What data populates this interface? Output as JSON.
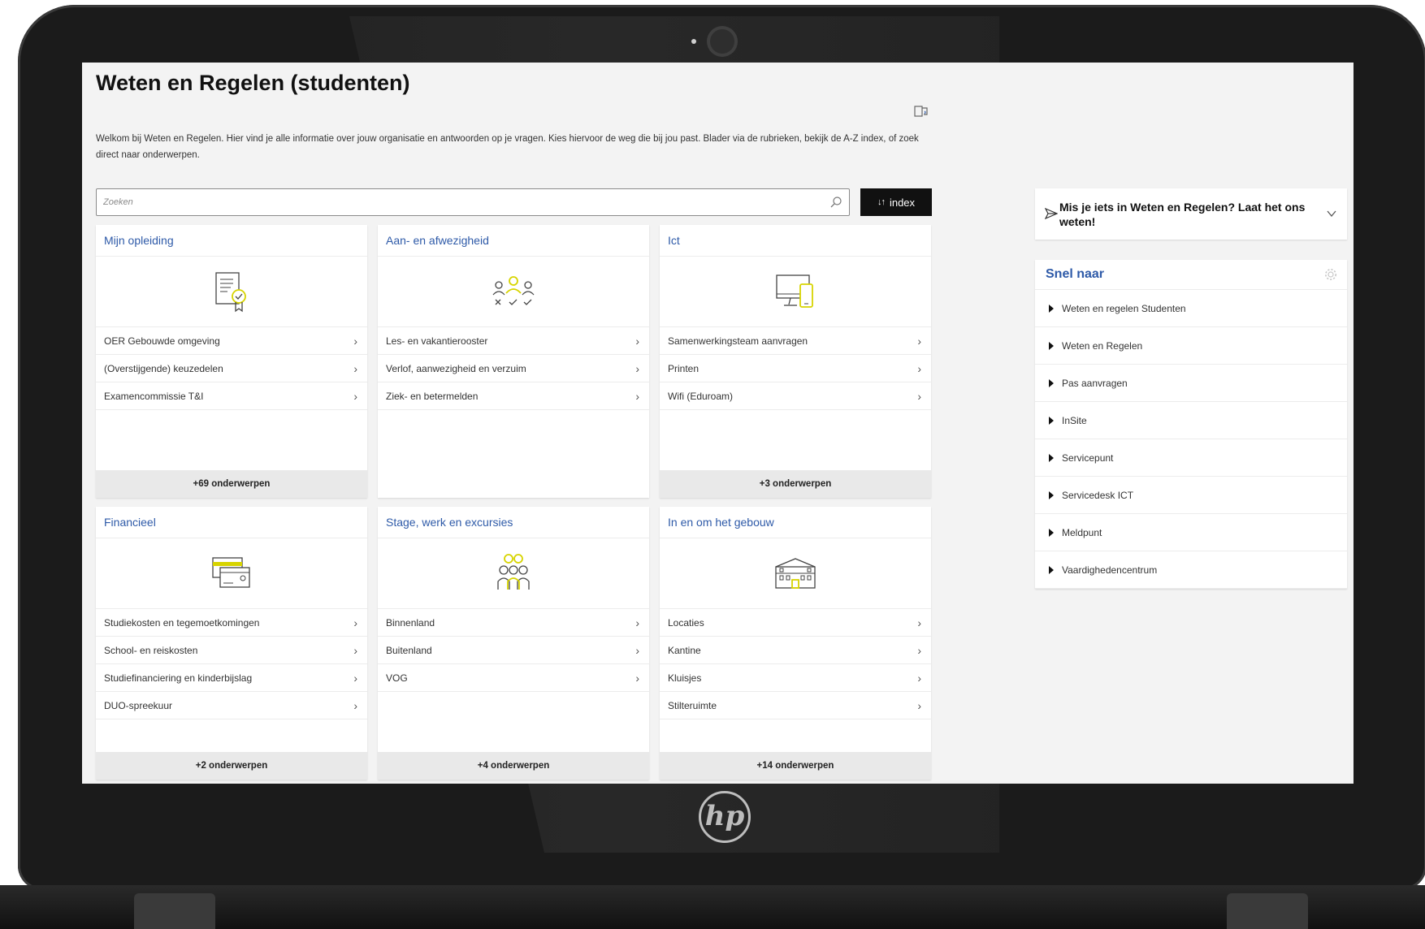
{
  "page": {
    "title": "Weten en Regelen (studenten)",
    "intro": "Welkom bij Weten en Regelen. Hier vind je alle informatie over jouw organisatie en antwoorden op je vragen. Kies hiervoor de weg die bij jou past. Blader via de rubrieken, bekijk de A-Z index, of zoek direct naar onderwerpen."
  },
  "search": {
    "placeholder": "Zoeken",
    "value": ""
  },
  "index_button": {
    "label": "index",
    "icon": "sort-icon"
  },
  "cards": [
    {
      "title": "Mijn opleiding",
      "icon": "certificate-icon",
      "links": [
        "OER Gebouwde omgeving",
        "(Overstijgende) keuzedelen",
        "Examencommissie T&I"
      ],
      "more": "+69 onderwerpen"
    },
    {
      "title": "Aan- en afwezigheid",
      "icon": "attendance-icon",
      "links": [
        "Les- en vakantierooster",
        "Verlof, aanwezigheid en verzuim",
        "Ziek- en betermelden"
      ],
      "more": ""
    },
    {
      "title": "Ict",
      "icon": "devices-icon",
      "links": [
        "Samenwerkingsteam aanvragen",
        "Printen",
        "Wifi (Eduroam)"
      ],
      "more": "+3 onderwerpen"
    },
    {
      "title": "Financieel",
      "icon": "credit-card-icon",
      "links": [
        "Studiekosten en tegemoetkomingen",
        "School- en reiskosten",
        "Studiefinanciering en kinderbijslag",
        "DUO-spreekuur"
      ],
      "more": "+2 onderwerpen"
    },
    {
      "title": "Stage, werk en excursies",
      "icon": "team-icon",
      "links": [
        "Binnenland",
        "Buitenland",
        "VOG"
      ],
      "more": "+4 onderwerpen"
    },
    {
      "title": "In en om het gebouw",
      "icon": "building-icon",
      "links": [
        "Locaties",
        "Kantine",
        "Kluisjes",
        "Stilteruimte"
      ],
      "more": "+14 onderwerpen"
    }
  ],
  "feedback": {
    "text": "Mis je iets in Weten en Regelen? Laat het ons weten!"
  },
  "snel_naar": {
    "title": "Snel naar",
    "items": [
      "Weten en regelen Studenten",
      "Weten en Regelen",
      "Pas aanvragen",
      "InSite",
      "Servicepunt",
      "Servicedesk ICT",
      "Meldpunt",
      "Vaardighedencentrum"
    ]
  },
  "device": {
    "brand": "hp"
  },
  "colors": {
    "accent": "#2e5aa8",
    "icon_highlight": "#d7d400",
    "button_bg": "#111111"
  }
}
